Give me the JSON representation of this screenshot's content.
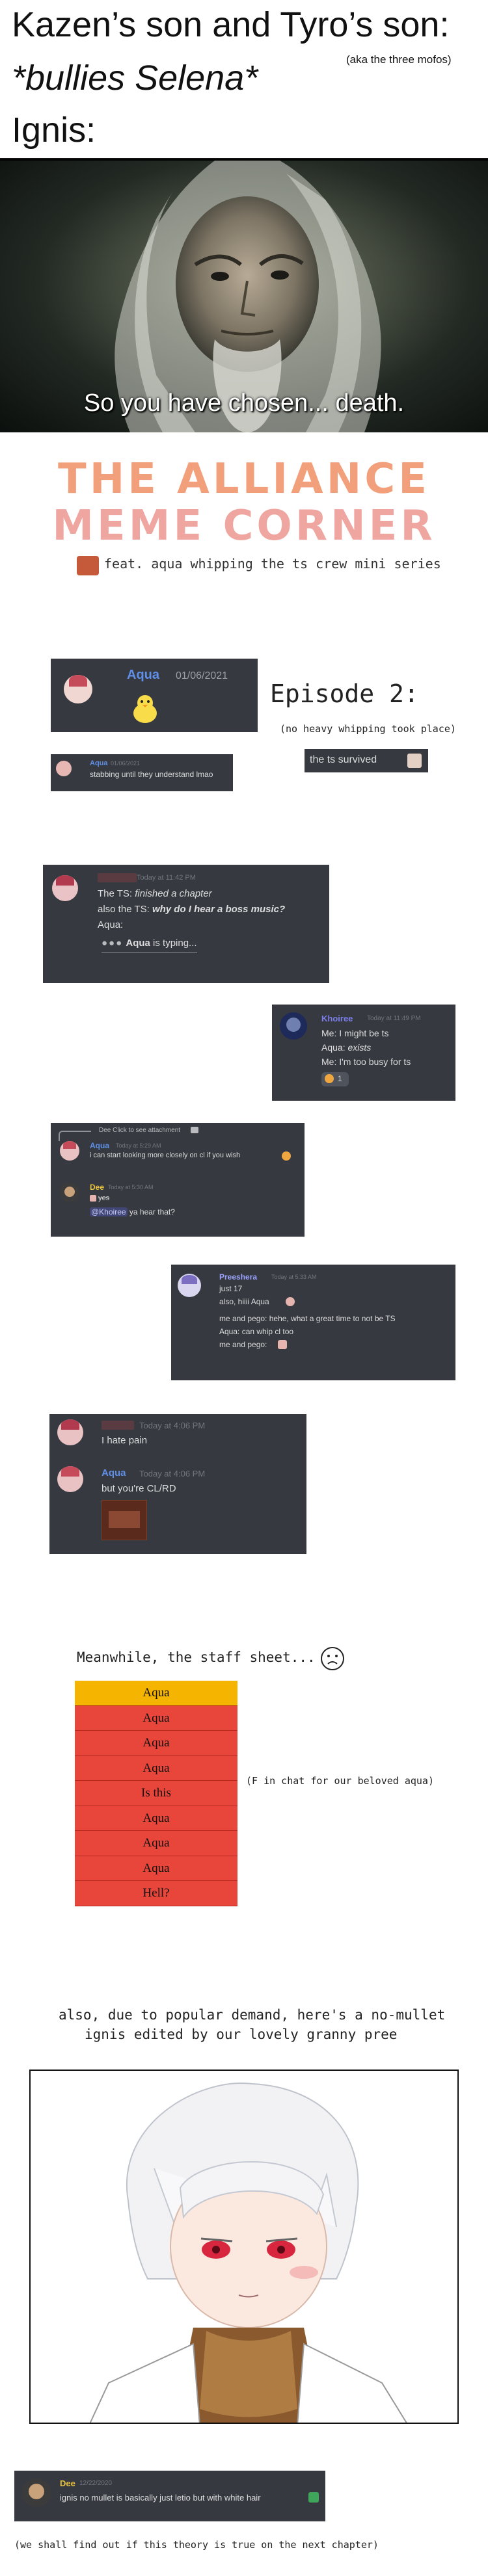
{
  "meme_top": {
    "line1": "Kazen’s son and Tyro’s son:",
    "aka": "(aka the three mofos)",
    "line2": "*bullies Selena*",
    "line3": "Ignis:",
    "subtitle": "So you have chosen... death."
  },
  "title": {
    "line1": "THE ALLIANCE",
    "line2": "MEME CORNER",
    "feat": "feat. aqua whipping the ts crew mini series"
  },
  "episode": {
    "title": "Episode 2:",
    "note": "(no heavy whipping took place)"
  },
  "card_aqua": {
    "name": "Aqua",
    "date": "01/06/2021",
    "duck_icon": "duck-icon"
  },
  "card_stab": {
    "name": "Aqua",
    "date": "01/06/2021",
    "text": "stabbing until they understand lmao"
  },
  "ts_survived": {
    "text": "the ts survived"
  },
  "chat1": {
    "time": "Today at 11:42 PM",
    "line1_prefix": "The TS: ",
    "line1_em": "finished a chapter",
    "line2_prefix": "also the TS: ",
    "line2_em": "why do I hear a boss music?",
    "line3": "Aqua:",
    "typing_name": "Aqua",
    "typing_rest": " is typing..."
  },
  "chat2": {
    "name": "Khoiree",
    "time": "Today at 11:49 PM",
    "line1": "Me: I might be ts",
    "line2_prefix": "Aqua: ",
    "line2_em": "exists",
    "line3": "Me: I'm too busy for ts",
    "reaction_count": "1"
  },
  "chat3": {
    "reply": "Dee Click to see attachment",
    "aqua_name": "Aqua",
    "aqua_time": "Today at 5:29 AM",
    "aqua_text": "i can start looking more closely on cl if you wish",
    "dee_name": "Dee",
    "dee_time": "Today at 5:30 AM",
    "dee_yes": "yes",
    "dee_mention": "@Khoiree",
    "dee_text": " ya hear that?"
  },
  "chat4": {
    "name": "Preeshera",
    "time": "Today at 5:33 AM",
    "line1": "just 17",
    "line2": "also, hiiii Aqua",
    "line3": "me and pego: hehe, what a great time to not be TS",
    "line4": "Aqua: can whip cl too",
    "line5": "me and pego:"
  },
  "chat5": {
    "time1": "Today at 4:06 PM",
    "text1": "I hate pain",
    "name2": "Aqua",
    "time2": "Today at 4:06 PM",
    "text2": "but you're CL/RD"
  },
  "staff": {
    "heading": "Meanwhile, the staff sheet...",
    "rows": [
      "Aqua",
      "Aqua",
      "Aqua",
      "Aqua",
      "Is this",
      "Aqua",
      "Aqua",
      "Aqua",
      "Hell?"
    ],
    "note": "(F in chat for our beloved aqua)"
  },
  "nomullet": {
    "line1": "also, due to popular demand, here's a no-mullet",
    "line2": "ignis edited by our lovely granny pree"
  },
  "chat6": {
    "name": "Dee",
    "time": "12/22/2020",
    "text": "ignis no mullet is basically just letio but with white hair"
  },
  "footer": "(we shall find out if this theory is true on the next chapter)",
  "colors": {
    "discord_bg": "#36393f",
    "aqua_name": "#5f8fe8",
    "dee_name": "#e8c33d",
    "khoiree_name": "#7b7ee8",
    "pree_name": "#9aa3ff",
    "red_name": "#c9424b",
    "sheet_header": "#f4b400",
    "sheet_row": "#e8463a"
  }
}
